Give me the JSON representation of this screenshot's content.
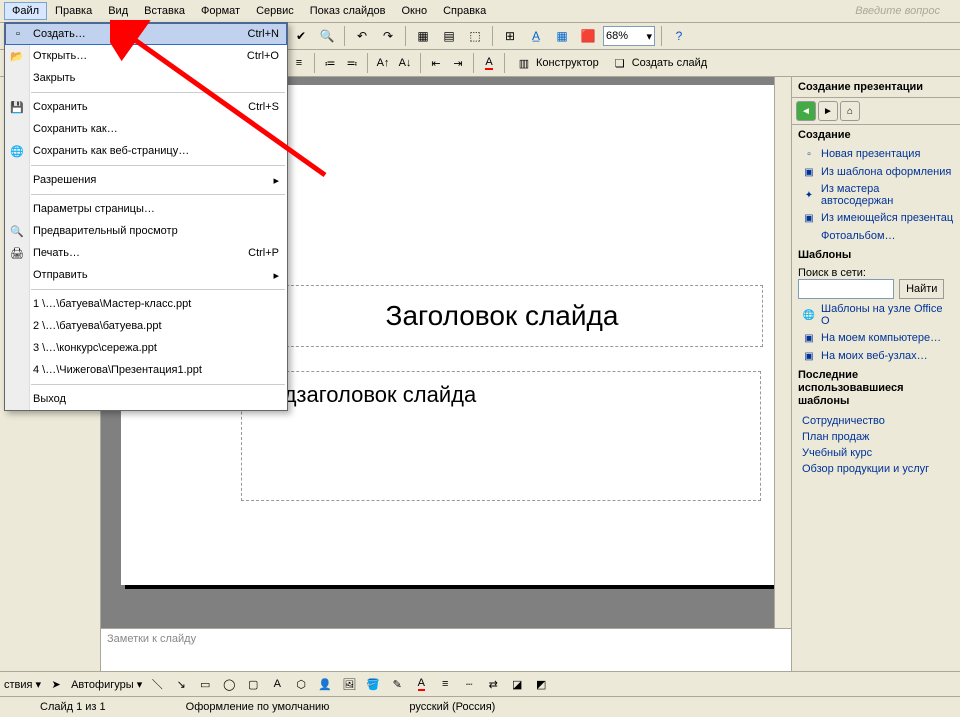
{
  "menubar": {
    "items": [
      "Файл",
      "Правка",
      "Вид",
      "Вставка",
      "Формат",
      "Сервис",
      "Показ слайдов",
      "Окно",
      "Справка"
    ],
    "ask_hint": "Введите вопрос"
  },
  "toolbar": {
    "zoom": "68%"
  },
  "toolbar2": {
    "designer": "Конструктор",
    "new_slide": "Создать слайд"
  },
  "filemenu": {
    "items": [
      {
        "label": "Создать…",
        "shortcut": "Ctrl+N",
        "icon": "new-doc",
        "hover": true
      },
      {
        "label": "Открыть…",
        "shortcut": "Ctrl+O",
        "icon": "open"
      },
      {
        "label": "Закрыть",
        "shortcut": ""
      },
      {
        "sep": true
      },
      {
        "label": "Сохранить",
        "shortcut": "Ctrl+S",
        "icon": "save"
      },
      {
        "label": "Сохранить как…",
        "shortcut": ""
      },
      {
        "label": "Сохранить как веб-страницу…",
        "shortcut": "",
        "icon": "web"
      },
      {
        "sep": true
      },
      {
        "label": "Разрешения",
        "shortcut": "",
        "submenu": true
      },
      {
        "sep": true
      },
      {
        "label": "Параметры страницы…",
        "shortcut": ""
      },
      {
        "label": "Предварительный просмотр",
        "shortcut": "",
        "icon": "preview"
      },
      {
        "label": "Печать…",
        "shortcut": "Ctrl+P",
        "icon": "print"
      },
      {
        "label": "Отправить",
        "shortcut": "",
        "submenu": true
      },
      {
        "sep": true
      },
      {
        "label": "1 \\…\\батуева\\Мастер-класс.ppt",
        "shortcut": ""
      },
      {
        "label": "2 \\…\\батуева\\батуева.ppt",
        "shortcut": ""
      },
      {
        "label": "3 \\…\\конкурс\\сережа.ppt",
        "shortcut": ""
      },
      {
        "label": "4 \\…\\Чижегова\\Презентация1.ppt",
        "shortcut": ""
      },
      {
        "sep": true
      },
      {
        "label": "Выход",
        "shortcut": ""
      }
    ]
  },
  "slide": {
    "title_placeholder": "Заголовок слайда",
    "subtitle_placeholder": "Подзаголовок слайда"
  },
  "notes": {
    "placeholder": "Заметки к слайду"
  },
  "taskpane": {
    "title": "Создание презентации",
    "sec_create": "Создание",
    "links_create": [
      "Новая презентация",
      "Из шаблона оформления",
      "Из мастера автосодержан",
      "Из имеющейся презентац",
      "Фотоальбом…"
    ],
    "sec_templates": "Шаблоны",
    "search_label": "Поиск в сети:",
    "search_btn": "Найти",
    "links_templates": [
      "Шаблоны на узле Office O",
      "На моем компьютере…",
      "На моих веб-узлах…"
    ],
    "sec_recent": "Последние использовавшиеся шаблоны",
    "links_recent": [
      "Сотрудничество",
      "План продаж",
      "Учебный курс",
      "Обзор продукции и услуг"
    ]
  },
  "bottombar": {
    "actions_label": "ствия",
    "autoshapes": "Автофигуры"
  },
  "statusbar": {
    "slide": "Слайд 1 из 1",
    "design": "Оформление по умолчанию",
    "lang": "русский (Россия)"
  }
}
